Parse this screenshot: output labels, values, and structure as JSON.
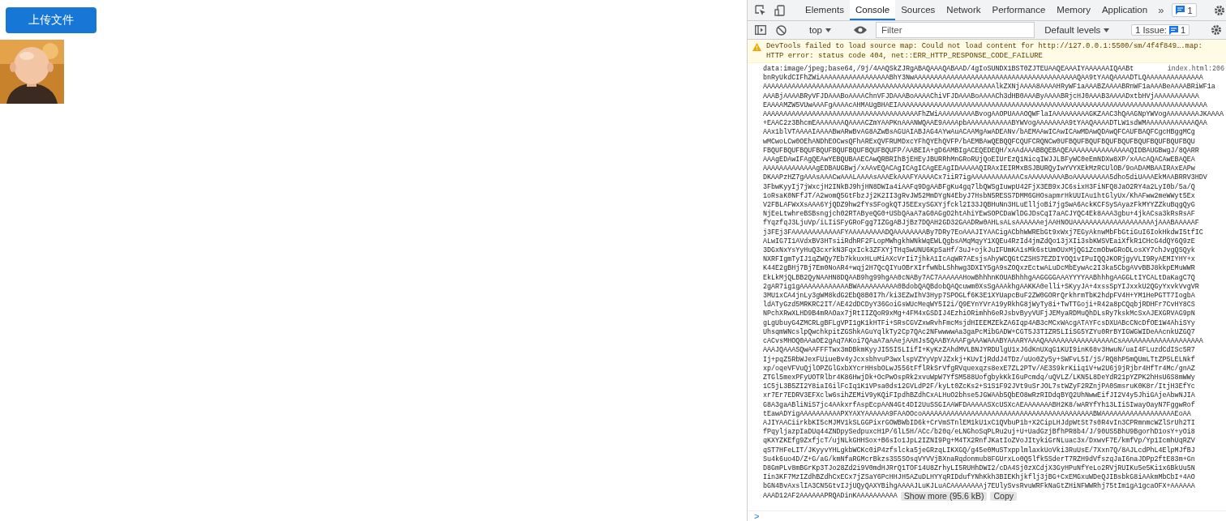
{
  "page": {
    "upload_button": "上传文件"
  },
  "devtools": {
    "tabs": [
      {
        "label": "Elements",
        "selected": false
      },
      {
        "label": "Console",
        "selected": true
      },
      {
        "label": "Sources",
        "selected": false
      },
      {
        "label": "Network",
        "selected": false
      },
      {
        "label": "Performance",
        "selected": false
      },
      {
        "label": "Memory",
        "selected": false
      },
      {
        "label": "Application",
        "selected": false
      }
    ],
    "more": "»",
    "messages_badge": "1",
    "context": "top",
    "filter": {
      "placeholder": "Filter"
    },
    "levels": "Default levels",
    "issues": {
      "label": "1 Issue:",
      "count": "1"
    },
    "warning": {
      "text_before": "DevTools failed to load source map: Could not load content for ",
      "link": "http://127.0.0.1:5500/sm/4f4f849….map",
      "text_after": ": HTTP error: status code 404, net::ERR_HTTP_RESPONSE_CODE_FAILURE"
    },
    "log": {
      "source": "index.html:206",
      "lines": [
        "data:image/jpeg;base64,/9j/4AAQSkZJRgABAQAAAQABAAD/4gIoSUNDX1BST0ZJTEUAAQEAAAIYAAAAAAIQAABt",
        "bnRyUkdCIFhZWiAAAAAAAAAAAAAAAAABhY3NwAAAAAAAAAAAAAAAAAAAAAAAAAAAAAAAAAAAAAAAAQAA9tYAAQAAAADTLQAAAAAAAAAAAAAA",
        "AAAAAAAAAAAAAAAAAAAAAAAAAAAAAAAAAAAAAAAAAAAAAAAAAAAAAAAAAlkZXNjAAAA8AAAAHRyWF1aAAABZAAAABRnWF1aAAABeAAAABRiWF1a",
        "AAABjAAAABRyVFJDAAABoAAAAChnVFJDAAABoAAAAChiVFJDAAABoAAAACh3dHB0AAAByAAAABRjcHJ0AAAB3AAAADxtbHVjAAAAAAAAAAA",
        "EAAAAMZW5VUwAAAFgAAAAcAHMAUgBHAEIAAAAAAAAAAAAAAAAAAAAAAAAAAAAAAAAAAAAAAAAAAAAAAAAAAAAAAAAAAAAAAAAAAAAAAAAAAAA",
        "AAAAAAAAAAAAAAAAAAAAAAAAAAAAAAAAAAAAAAFhZWiAAAAAAAAABvogAAOPUAAAOQWFlaIAAAAAAAAAGKZAAC3hQAAGNpYWVogAAAAAAAAJKAAAA",
        "+EAAC2z3BhcmEAAAAAAAQAAAACZmYAAPKnAAANWQAAE9AAAApbAAAAAAAAAAABYWVogAAAAAAAA9tYAAQAAAADTLW1sdWMAAAAAAAAAAAAQAA",
        "AAx1blVTAAAAIAAAABwARwBvAG8AZwBsAGUAIABJAG4AYwAuACAAMgAwADEANv/bAEMAAwICAwICAwMDAwQDAwQFCAUFBAQFCgcHBggMCg",
        "wMCwoLCw0OEhANDhEOCwsQFhARExQVFRUMDxcYFhQYEhQVFP/bAEMBAwQEBQQFCQUFCRQNCw0UFBQUFBQUFBQUFBQUFBQUFBQUFBQUFBQU",
        "FBQUFBQUFBQUFBQUFBQUFBQUFBQUFBQUFP/AABEIA+gD6AMBIgACEQEDEQH/xAAdAAABBQEBAQEAAAAAAAAAAAAAAAQIDBAUGBwgJ/8QARR",
        "AAAgEDAwIFAgQEAwYEBQUBAAECAwQRBRIhBjEHEyJBURRhMnGRoRUjQoEIUrEzQ1NicqIWJJLBFyWC0eEmNDXw8XP/xAAcAQACAwEBAQEA",
        "AAAAAAAAAAAAAgEDBAUGBwj/xAAvEQACAgICAgICAgEEAgIDAAAAAQIRAxIEIRMxBSJBURQyIwYVYXEkMzRCUlOB/9oADAMBAAIRAxEAPw",
        "DKAAPzHZ7gAAAsAAACwAAALAAAAsAAAEkAAAFYAAAACx7iiR7igAAAAAAAAAAAACsAAAAAAAAABoAAAAAAAAA5dho5diUAAAEkMAABRRV3HDV",
        "3FbwKyyIj7jWxcjH2INkBJ9hjHN8DWIa4iAAFq9DgAABFgKu4gq7lbQWSgIuwpU42FjX3EB9xJC6sixH3FiNFQ8JaO2RY4a2LyI0b/5a/Q",
        "1oRsaK0NFfJT/A2womQ5GtFbzJj2K2II3gRvJW52MmDYgN4EbyJ7HsbN5RESS7DMM6GHOsapmrHkUUIAu1htGlyUx/KhAFww2meWWyt5Ex",
        "V2FBLAFWxXsAAA6YjQDZ9hw2fYsSFogkQTJ5EExySGXYjfckl2I33JQBHuNn3HLuElljoBi7jgSwA6AckKCFSySAyazFkMYYZZkuBqgQyG",
        "NjEeLtwhreBSBsngjch02RTAByeQG0+USbQAaA7aG0AGgO2htAhiYEwSOPCDaWlDGJDsCqI7aACJYQC4Ek8AAA3gbu+4jkACsa3kRsRsAF",
        "fYqzfqJ3LjuVp/iLIiSFyGRoFgg7IZGgABJjBz7DQAH2GD32GAADRw0AHLsALsAAAAAAejAAHNOUAAAAAAAAAAAAAAAAAAAAjAAABAAAAAF",
        "j3FEj3FAAAAAAAAAAAAFYAAAAAAAAADQAAAAAAAABy7DRy7EoAAAJIYAACigACbhWWREbGt9xWxj7EGyAknwMbFbGtiGuI6IokHkdwI5tfIC",
        "ALwIG7I1AVdxBV3HTsiiRdhRF2FLopMWhgkhWNkWqEWLQgbsAMqMqyY1XQEu4RzId4jmZdQo13jXIi3sbKWSVEaiXfkR1CHcG4dQY6Q9zE",
        "3DGxNxYsYyHuQ3cxrkN3FqxIck3ZFXYjTHqSwUNU6KpSaHf/3uJ+ojkJuIFUmKA1sMk6stUmOUxMjQG1ZcmObwGRoDLosXY7chJvgQSQyk",
        "NXRFIgmTyIJ1qZWQy7Eb7kkuxHLuMiAXcVrIi7jhkA1IcAqWR7AEsjsAhyWCQGtCZSHS7EZDIYOQ1vIPuIQQJKORjgyVLI9RyAEMIYHY+x",
        "K44E2gBHj7Bj7Em0NoAR4+wqj2H7QcQIYuOBrXIrfwNbLShhwg3DXIY5gA9sZOQxzEctwALuDcMbEywAc2I3ka5CbgAVvBBJ8kkpEMuWWR",
        "EkLkMjQLBB2QyNAAHN8DQAAB9hg99hgAA0cNABy7AC7AAAAAAHowBhhhnKOUABhhhgAAGGGGAAAYYYYAABhhhgAAGGLtIYCALtDaKagC7Q",
        "2gAR7ig1gAAAAAAAAAAAABWAAAAAAAAAA0BdobQAQBdobQAQcuwm0XsSgAAAkhgAAKKA0elli+SKyyJA+4xssSpYIJxxkU2QGyYxvkVvgVR",
        "3MU1xCA4jnLy3gWM8kdG2EbQ8B0I7h/ki3EZwIhV3Hyp7SPOGLf6K3E1XYUapcBuF2ZW0GORrQrkhrmTbK2hdpFV4H+YM1HePGTT7IogbA",
        "ldATyGzd5MRKRC2IT/AE42dDCDyY36GoiGsWUcMeqWY5I2i/Q9EYnYVrA19yRkhG8jWyTy8i+TwTTGoji+R42a8pCQqbjRDHFr7CvHY8CS",
        "NPchXRwXLHD9B4mRAOax7jRtIIZQoR9xMg+4FM4xGSDIJ4EzhiORimhh6eRJsbvByyVUFjJEMyaRDMuQhDLsRy7kskMcSxAJEXGRVAG9pN",
        "gLgUbuyG4ZMCRLgBFLgVPI1gK1kHTFi+SRsCGVZxwRvhFmcMsjdHIEEMZEkZA6Iqp4AB3cMCxWAcgATAYFcsDXUABcCNcDfOE1W4AhiSYy",
        "UhsqmWNcslpQwchkpitZGShkAGuYqlkTy2Cp7QAc2NFwwwwAa3gaPcMibGADW+CGT5J3TIZR5LIiSG5YZYu0RrBYIGWGWIDeAAcnkUZGQ7",
        "cACvsMHOQ0AAaOE2gAq7AKoi7QAaA7aAAejAAHJs5QAABYAAAFgAAAWAAABYAAARYAAAQAAAAAAAAAAAAAAAAACsAAAAAAAAAAAAAAAAAAAA",
        "AAAJQAAASQwAAFFFTwx3mDBkmKyyJI55I5LIifI+KyKzZAhdMVLBNJYRDUlgU1xJ6dKnUXqG1KUI9inK68v3HwuN/uaI4FLuzdCdISc5R7",
        "Ij+pqZ5RbWJexFUiueBv4yJcxsbhvuP3wxlspVZYyVpVJZxkj+KUvIjRddJ4TDz/uUo0Zy5y+SWFvL5I/jS/RQ8hP5mQUmLTtZP5LELNkf",
        "xp/oqeVFVuQjlOPZGlGxbXYcrHHsbOLwJ556tFflRkSrVfgRVquexqzs8exE7ZL2PTv/AE3S9krKiiq1V+w2U6j9jRjbr4HfTr4Mc/gnAZ",
        "ZTGl5mexPFyUOTRlbr4K86HwjDk+OcPwOspRk2xvuWpW7YfSM588UofgbykKkI6uPcmdq/uQVLZ/LKN5L8DeYdR21pYZPK2hHsU6S8mWWy",
        "1C5jL3B5ZI2Y8iaI6ilFcIq1K1VPsa0ds12GVLdP2F/kyLt0ZcKs2+S1S1F92JVt9uSrJOL7stWZyF2RZnjPA0SmsruK0K8r/ItjH3EfYc",
        "xr7Er7EDRV3EFXclw6sihZEMiV9yKQiFIpdhBZdhCxALHuO2bhse5JGWAAb5QbEO8wRzRIDdqBYQ2UhNwwEifJI2V4y5JhiGAjeAbwNJIA",
        "G8A3gaABliNiS7jc4AAkxrfAspEcpAAN4Gt4DI2UuSSGIAAWFDAAAAASXcUSXcAEAAAAAAABH2K8/wARYfYh13LIiSIwayOayN7FggwRof",
        "tEawADYigAAAAAAAAAAPXYAXYAAAAAA9FAAOOcoAAAAAAAAAAAAAAAAAAAAAAAAAAAAAAAAAAAAAAAAAABWAAAAAAAAAAAAAAAAAAEoAA",
        "AJIYAACiirkbKI5cMJMV1kSLGGPixrGOWBWbID6k+CrVmSTnlEM1kU1xC1QVbuP1b+X2CipLHJdpWtSt7s0R4vIn3CPRmnmcWZlSrUh2TI",
        "fPqyljazpIaDUq44ZNDpySedpuxcH1P/6lL5H/ACc/b20q/eLNGhoSqPLRu2uj+U+UadGzjBfhPR8b4/J/90US5BhU9BgorhD1osY+yOi8",
        "qKXYZKEfg9ZxfjcT/ujNLkGHHSox+B6sIo1JpL2IZNI9Pg+M4TX2RnfJKatIoZVoJItykiGrNLuac3x/DxwvF7E/kmfVp/Yp1IcmhUqRZV",
        "qST7HFeLIT/JKyyvYHLgkbWCKc0iP4zfslcka5jeGRzqLIKXGQ/g45e0MuSTxpplmlaxkUoVki3RuUsE/7Xxn7Q/8AJLcdPhL4ElpMJfBJ",
        "Su4k6uo4D/Z+G/aG/kmNfaRGMcrBkzs3S5SOsqVYVVjBXnaRqdonmub8FGUrxLo0Q5lfk5SderT7RZH9dVfszqJaI6naJDPp2ftE83m+Gn",
        "D8GmPLv8mBGrKp3TJo28Zd2i9V0mdHJRrQ1TOF14U8ZrhyLI5RUHhDWI2/cDA4Sj0zXCdjX3GyHPuNfYeLo2RVjRUIKu5e5Ki1x6BkUu5N",
        "Iin3KF7MzIZdhBZdhCxECx7jZSaY6PcHHJH5AZuDLHYYqRIDdufYNhKkh3BIEKhjkflj3jBG+CxEMGxuWDeQJIBsbkG8iAAkmMbCbI+4AO",
        "bGN4BvAxslIA3CN5GtvIJjUQyQAXYBihgAAAAJLuKJLuACAAAAAAAAj7EUlySvsRvuWRFkNaGtZHiNFWWRhj75tIm1gA1gcaOFX+AAAAAA",
        "AAAD12AF2AAAAAAPRQADinKAAAAAAAAAA"
      ],
      "show_more": "Show more (95.6 kB)",
      "copy": "Copy"
    },
    "prompt": ">"
  }
}
